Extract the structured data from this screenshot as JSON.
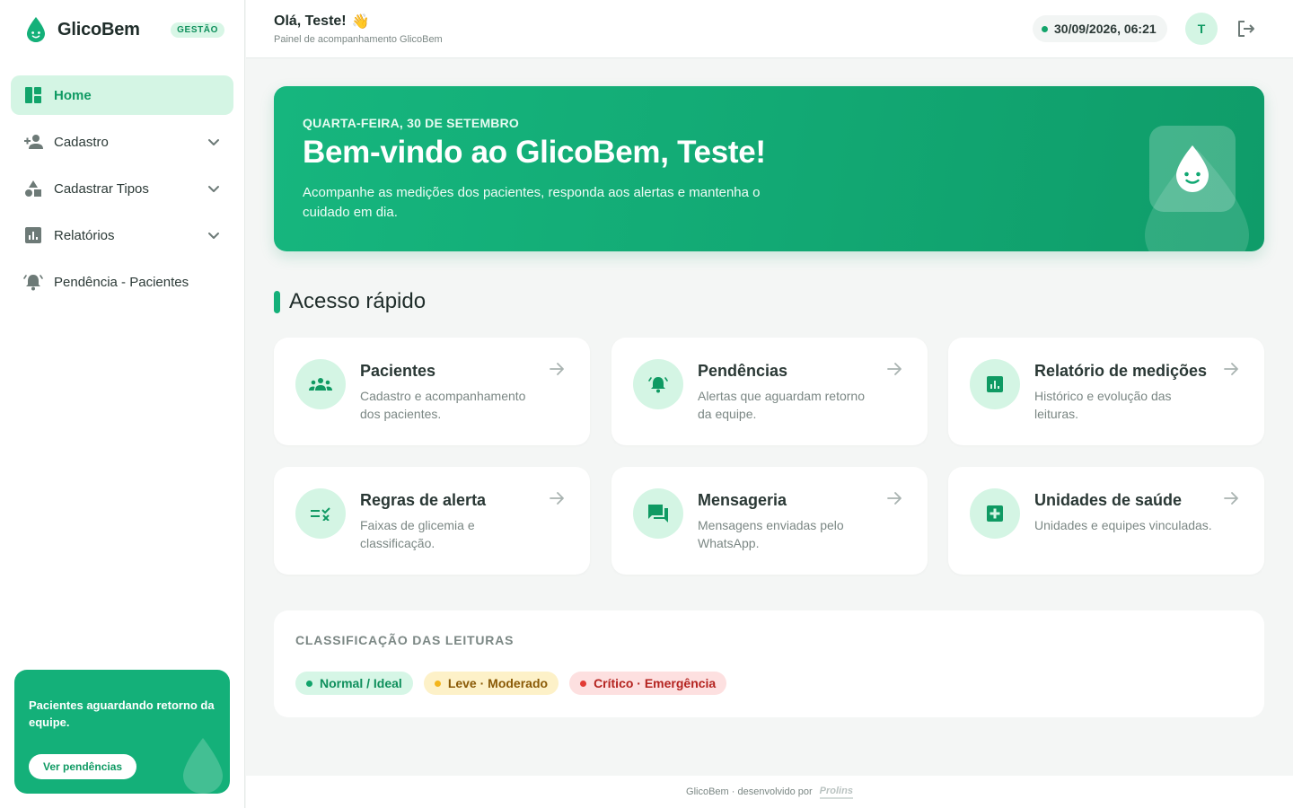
{
  "brand": {
    "name": "GlicoBem",
    "badge": "GESTÃO"
  },
  "nav": {
    "items": [
      {
        "label": "Home",
        "icon": "dashboard-icon",
        "active": true
      },
      {
        "label": "Cadastro",
        "icon": "person-add-icon",
        "expandable": true
      },
      {
        "label": "Cadastrar Tipos",
        "icon": "shapes-icon",
        "expandable": true
      },
      {
        "label": "Relatórios",
        "icon": "bar-chart-icon",
        "expandable": true
      },
      {
        "label": "Pendência - Pacientes",
        "icon": "alarm-bell-icon"
      }
    ]
  },
  "promo": {
    "text": "Pacientes aguardando retorno da equipe.",
    "button": "Ver pendências"
  },
  "header": {
    "greeting": "Olá, Teste!",
    "wave": "👋",
    "subtitle": "Painel de acompanhamento GlicoBem",
    "datetime": "30/09/2026, 06:21",
    "avatar_initial": "T"
  },
  "hero": {
    "date": "QUARTA-FEIRA, 30 DE SETEMBRO",
    "title": "Bem-vindo ao GlicoBem, Teste!",
    "description": "Acompanhe as medições dos pacientes, responda aos alertas e mantenha o cuidado em dia."
  },
  "quick_access": {
    "title": "Acesso rápido",
    "cards": [
      {
        "title": "Pacientes",
        "desc": "Cadastro e acompanhamento dos pacientes.",
        "icon": "groups-icon"
      },
      {
        "title": "Pendências",
        "desc": "Alertas que aguardam retorno da equipe.",
        "icon": "alarm-bell-icon"
      },
      {
        "title": "Relatório de medições",
        "desc": "Histórico e evolução das leituras.",
        "icon": "bar-chart-icon"
      },
      {
        "title": "Regras de alerta",
        "desc": "Faixas de glicemia e classificação.",
        "icon": "rule-icon"
      },
      {
        "title": "Mensageria",
        "desc": "Mensagens enviadas pelo WhatsApp.",
        "icon": "chat-icon"
      },
      {
        "title": "Unidades de saúde",
        "desc": "Unidades e equipes vinculadas.",
        "icon": "medical-cross-icon"
      }
    ]
  },
  "classification": {
    "title": "CLASSIFICAÇÃO DAS LEITURAS",
    "levels": [
      {
        "label": "Normal / Ideal",
        "color": "#12a46b"
      },
      {
        "label": "Leve · Moderado",
        "color": "#f3b51c"
      },
      {
        "label": "Crítico · Emergência",
        "color": "#e23b35"
      }
    ]
  },
  "footer": {
    "text": "GlicoBem · desenvolvido por",
    "logo": "Prolins"
  },
  "colors": {
    "primary": "#14b079",
    "primary_light": "#d4f5e4"
  }
}
